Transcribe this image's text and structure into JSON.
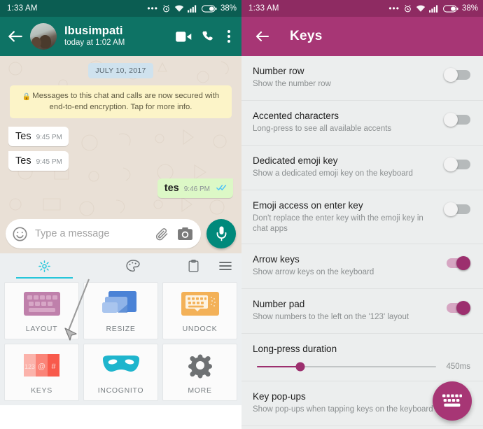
{
  "colors": {
    "whatsapp_header": "#0e7365",
    "whatsapp_statusbar": "#0b5d52",
    "keys_header": "#a73675",
    "keys_statusbar": "#8e2b62",
    "accent_magenta": "#9c2f6e",
    "fab": "#a73675",
    "chat_background": "#e9e0d6",
    "outgoing_bubble": "#dcf8c6",
    "incoming_bubble": "#ffffff",
    "date_chip": "#cfe2ee",
    "encryption_notice": "#fcf4c8",
    "toolbar_active": "#26c6da",
    "mic_fab": "#00897b"
  },
  "left_pane": {
    "statusbar": {
      "time": "1:33 AM",
      "battery_percent": "38%",
      "icons": [
        "more-dots-icon",
        "alarm-icon",
        "wifi-icon",
        "signal-icon",
        "battery-icon"
      ]
    },
    "header": {
      "back_label": "back-arrow",
      "contact_name": "Ibusimpati",
      "contact_status": "today at 1:02 AM",
      "actions": [
        "video-call-icon",
        "voice-call-icon",
        "overflow-menu-icon"
      ]
    },
    "chat": {
      "date_divider": "JULY 10, 2017",
      "encryption_notice": "Messages to this chat and calls are now secured with end-to-end encryption. Tap for more info.",
      "messages": [
        {
          "text": "Tes",
          "time": "9:45 PM",
          "direction": "incoming",
          "status": ""
        },
        {
          "text": "Tes",
          "time": "9:45 PM",
          "direction": "incoming",
          "status": ""
        },
        {
          "text": "tes",
          "time": "9:46 PM",
          "direction": "outgoing",
          "status": "read"
        }
      ]
    },
    "composer": {
      "placeholder": "Type a message",
      "emoji_icon": "smiley-icon",
      "attach_icon": "paperclip-icon",
      "camera_icon": "camera-icon",
      "mic_icon": "microphone-icon"
    },
    "keyboard_toolbar": {
      "tabs": [
        {
          "icon": "gear-icon",
          "active": true
        },
        {
          "icon": "theme-palette-icon",
          "active": false
        },
        {
          "icon": "clipboard-icon",
          "active": false
        },
        {
          "icon": "hamburger-menu-icon",
          "active": false
        }
      ]
    },
    "keyboard_cards": [
      {
        "label": "LAYOUT",
        "icon": "keyboard-layout-icon",
        "color": "#bf80ab"
      },
      {
        "label": "RESIZE",
        "icon": "resize-windows-icon",
        "color": "#5b8cd9"
      },
      {
        "label": "UNDOCK",
        "icon": "undock-keyboard-icon",
        "color": "#f0ad4e"
      },
      {
        "label": "KEYS",
        "icon": "special-keys-icon",
        "color": "#f96a5d"
      },
      {
        "label": "INCOGNITO",
        "icon": "mask-icon",
        "color": "#1fb5cd"
      },
      {
        "label": "MORE",
        "icon": "gear-icon",
        "color": "#6e7173"
      }
    ],
    "cursor": {
      "name": "mouse-pointer",
      "over_card": "KEYS"
    }
  },
  "right_pane": {
    "statusbar": {
      "time": "1:33 AM",
      "battery_percent": "38%",
      "icons": [
        "more-dots-icon",
        "alarm-icon",
        "wifi-icon",
        "signal-icon",
        "battery-icon"
      ]
    },
    "header": {
      "back_label": "back-arrow",
      "title": "Keys"
    },
    "settings": [
      {
        "type": "toggle",
        "title": "Number row",
        "subtitle": "Show the number row",
        "value": false
      },
      {
        "type": "toggle",
        "title": "Accented characters",
        "subtitle": "Long-press to see all available accents",
        "value": false
      },
      {
        "type": "toggle",
        "title": "Dedicated emoji key",
        "subtitle": "Show a dedicated emoji key on the keyboard",
        "value": false
      },
      {
        "type": "toggle",
        "title": "Emoji access on enter key",
        "subtitle": "Don't replace the enter key with the emoji key in chat apps",
        "value": false
      },
      {
        "type": "toggle",
        "title": "Arrow keys",
        "subtitle": "Show arrow keys on the keyboard",
        "value": true
      },
      {
        "type": "toggle",
        "title": "Number pad",
        "subtitle": "Show numbers to the left on the '123' layout",
        "value": true
      },
      {
        "type": "slider",
        "title": "Long-press duration",
        "value_label": "450ms",
        "fill_percent": 24
      },
      {
        "type": "toggle",
        "title": "Key pop-ups",
        "subtitle": "Show pop-ups when tapping keys on the keyboard",
        "value": true
      }
    ],
    "fab": {
      "icon": "keyboard-icon"
    }
  }
}
